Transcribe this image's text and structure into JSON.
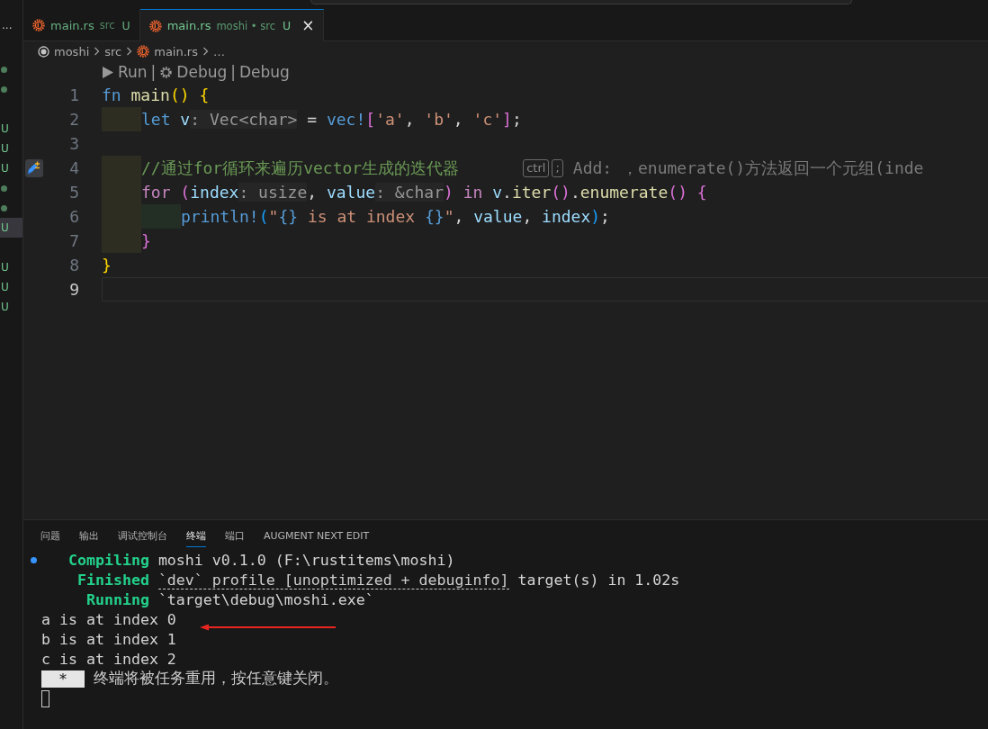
{
  "sidebar": {
    "more": "...",
    "badges": [
      {
        "kind": "dot",
        "selected": false
      },
      {
        "kind": "dot",
        "selected": false
      },
      {
        "kind": "empty",
        "selected": false
      },
      {
        "kind": "letter",
        "text": "U",
        "selected": false
      },
      {
        "kind": "letter",
        "text": "U",
        "selected": false
      },
      {
        "kind": "letter",
        "text": "U",
        "selected": false
      },
      {
        "kind": "dot",
        "selected": false
      },
      {
        "kind": "dot",
        "selected": false
      },
      {
        "kind": "letter",
        "text": "U",
        "selected": true
      },
      {
        "kind": "empty",
        "selected": false
      },
      {
        "kind": "letter",
        "text": "U",
        "selected": false
      },
      {
        "kind": "letter",
        "text": "U",
        "selected": false
      },
      {
        "kind": "letter",
        "text": "U",
        "selected": false
      }
    ]
  },
  "tabs": [
    {
      "label": "main.rs",
      "description": "src",
      "status": "U",
      "selected": false
    },
    {
      "label": "main.rs",
      "description": "moshi • src",
      "status": "U",
      "selected": true,
      "close": "×"
    }
  ],
  "breadcrumbs": [
    {
      "kind": "project",
      "label": "moshi"
    },
    {
      "kind": "folder",
      "label": "src"
    },
    {
      "kind": "file",
      "label": "main.rs"
    },
    {
      "kind": "symbol",
      "label": "…"
    }
  ],
  "codelens": {
    "separator": "|",
    "items": [
      {
        "kind": "run",
        "label": "Run"
      },
      {
        "kind": "debug",
        "label": "Debug"
      },
      {
        "kind": "plain",
        "label": "Debug"
      }
    ]
  },
  "lines": [
    {
      "number": "1",
      "current": false,
      "tokens": [
        {
          "kind": "kw",
          "text": "fn "
        },
        {
          "kind": "fn",
          "text": "main"
        },
        {
          "kind": "b1",
          "text": "() {"
        }
      ]
    },
    {
      "number": "2",
      "current": false,
      "guides": [
        {
          "color": "#2e2d22"
        }
      ],
      "tokens": [
        {
          "kind": "kw",
          "text": "let "
        },
        {
          "kind": "var",
          "text": "v"
        },
        {
          "kind": "hint",
          "text": ": Vec<char>"
        },
        {
          "kind": "plain",
          "text": " = "
        },
        {
          "kind": "macro",
          "text": "vec!"
        },
        {
          "kind": "b2",
          "text": "["
        },
        {
          "kind": "str",
          "text": "'a'"
        },
        {
          "kind": "plain",
          "text": ", "
        },
        {
          "kind": "str",
          "text": "'b'"
        },
        {
          "kind": "plain",
          "text": ", "
        },
        {
          "kind": "str",
          "text": "'c'"
        },
        {
          "kind": "b2",
          "text": "]"
        },
        {
          "kind": "plain",
          "text": ";"
        }
      ]
    },
    {
      "number": "3",
      "current": false
    },
    {
      "number": "4",
      "current": false,
      "kind": "edited",
      "guides": [
        {
          "color": "#2e2d22"
        }
      ],
      "tokens": [
        {
          "kind": "comment",
          "text": "//通过for循环来遍历vector生成的迭代器"
        }
      ],
      "suggestion": {
        "keys": [
          "ctrl",
          ";"
        ],
        "text": "Add: ，enumerate()方法返回一个元组(inde"
      }
    },
    {
      "number": "5",
      "current": false,
      "guides": [
        {
          "color": "#2e2d22"
        }
      ],
      "tokens": [
        {
          "kind": "ctrl",
          "text": "for "
        },
        {
          "kind": "b2",
          "text": "("
        },
        {
          "kind": "var",
          "text": "index"
        },
        {
          "kind": "hint",
          "text": ": usize"
        },
        {
          "kind": "plain",
          "text": ", "
        },
        {
          "kind": "var",
          "text": "value"
        },
        {
          "kind": "hint",
          "text": ": &char"
        },
        {
          "kind": "b2",
          "text": ") "
        },
        {
          "kind": "ctrl",
          "text": "in "
        },
        {
          "kind": "var",
          "text": "v"
        },
        {
          "kind": "plain",
          "text": "."
        },
        {
          "kind": "fn",
          "text": "iter"
        },
        {
          "kind": "b2",
          "text": "()"
        },
        {
          "kind": "plain",
          "text": "."
        },
        {
          "kind": "fn",
          "text": "enumerate"
        },
        {
          "kind": "b2",
          "text": "() {"
        }
      ]
    },
    {
      "number": "6",
      "current": false,
      "guides": [
        {
          "color": "#2e2d22"
        },
        {
          "color": "#232e25"
        }
      ],
      "tokens": [
        {
          "kind": "macro",
          "text": "println!"
        },
        {
          "kind": "b3",
          "text": "("
        },
        {
          "kind": "str",
          "text": "\""
        },
        {
          "kind": "fmt",
          "text": "{}"
        },
        {
          "kind": "str",
          "text": " is at index "
        },
        {
          "kind": "fmt",
          "text": "{}"
        },
        {
          "kind": "str",
          "text": "\""
        },
        {
          "kind": "plain",
          "text": ", "
        },
        {
          "kind": "var",
          "text": "value"
        },
        {
          "kind": "plain",
          "text": ", "
        },
        {
          "kind": "var",
          "text": "index"
        },
        {
          "kind": "b3",
          "text": ")"
        },
        {
          "kind": "plain",
          "text": ";"
        }
      ]
    },
    {
      "number": "7",
      "current": false,
      "guides": [
        {
          "color": "#2e2d22"
        }
      ],
      "tokens": [
        {
          "kind": "b2",
          "text": "}"
        }
      ]
    },
    {
      "number": "8",
      "current": false,
      "tokens": [
        {
          "kind": "b1",
          "text": "}"
        }
      ]
    },
    {
      "number": "9",
      "current": true
    }
  ],
  "panel": {
    "tabs": [
      {
        "label": "问题",
        "selected": false
      },
      {
        "label": "输出",
        "selected": false
      },
      {
        "label": "调试控制台",
        "selected": false
      },
      {
        "label": "终端",
        "selected": true
      },
      {
        "label": "端口",
        "selected": false
      },
      {
        "label": "AUGMENT NEXT EDIT",
        "selected": false
      }
    ],
    "terminal": [
      {
        "kind": "text",
        "marked": true,
        "tokens": [
          {
            "kind": "status",
            "text": "   Compiling"
          },
          {
            "kind": "plain",
            "text": " moshi v0.1.0 (F:\\rustitems\\moshi)"
          }
        ]
      },
      {
        "kind": "text",
        "marked": false,
        "tokens": [
          {
            "kind": "status",
            "text": "    Finished "
          },
          {
            "kind": "link",
            "text": "`dev` profile [unoptimized + debuginfo]"
          },
          {
            "kind": "plain",
            "text": " target(s) in 1.02s"
          }
        ]
      },
      {
        "kind": "text",
        "marked": false,
        "tokens": [
          {
            "kind": "status",
            "text": "     Running"
          },
          {
            "kind": "plain",
            "text": " `target\\debug\\moshi.exe`"
          }
        ]
      },
      {
        "kind": "text",
        "marked": false,
        "tokens": [
          {
            "kind": "plain",
            "text": "a is at index 0"
          }
        ]
      },
      {
        "kind": "text",
        "marked": false,
        "tokens": [
          {
            "kind": "plain",
            "text": "b is at index 1"
          }
        ]
      },
      {
        "kind": "text",
        "marked": false,
        "tokens": [
          {
            "kind": "plain",
            "text": "c is at index 2"
          }
        ]
      },
      {
        "kind": "prompt",
        "marked": false,
        "badge": "*",
        "text": "终端将被任务重用，按任意键关闭。"
      },
      {
        "kind": "cursor",
        "marked": false
      }
    ],
    "annotation": {
      "kind": "arrow",
      "color": "#e8251f"
    }
  }
}
